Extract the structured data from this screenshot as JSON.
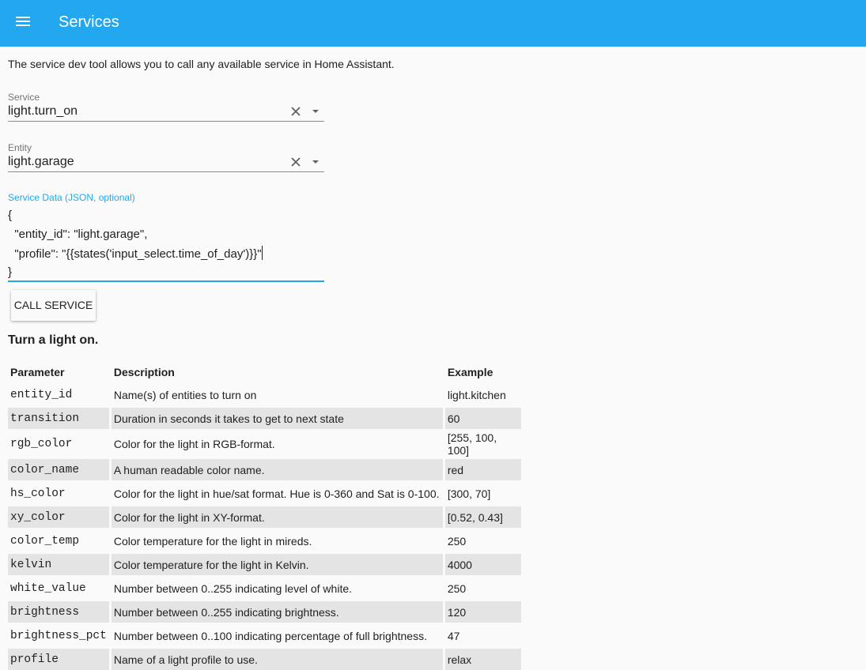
{
  "header": {
    "title": "Services",
    "menu_icon": "hamburger-menu-icon"
  },
  "intro": "The service dev tool allows you to call any available service in Home Assistant.",
  "service_field": {
    "label": "Service",
    "value": "light.turn_on"
  },
  "entity_field": {
    "label": "Entity",
    "value": "light.garage"
  },
  "service_data": {
    "label": "Service Data (JSON, optional)",
    "lines": [
      "{",
      "  \"entity_id\": \"light.garage\",",
      "  \"profile\": \"{{states('input_select.time_of_day')}}\"",
      "}"
    ]
  },
  "call_button": "CALL SERVICE",
  "section_title": "Turn a light on.",
  "table": {
    "headers": [
      "Parameter",
      "Description",
      "Example"
    ],
    "rows": [
      [
        "entity_id",
        "Name(s) of entities to turn on",
        "light.kitchen"
      ],
      [
        "transition",
        "Duration in seconds it takes to get to next state",
        "60"
      ],
      [
        "rgb_color",
        "Color for the light in RGB-format.",
        "[255, 100, 100]"
      ],
      [
        "color_name",
        "A human readable color name.",
        "red"
      ],
      [
        "hs_color",
        "Color for the light in hue/sat format. Hue is 0-360 and Sat is 0-100.",
        "[300, 70]"
      ],
      [
        "xy_color",
        "Color for the light in XY-format.",
        "[0.52, 0.43]"
      ],
      [
        "color_temp",
        "Color temperature for the light in mireds.",
        "250"
      ],
      [
        "kelvin",
        "Color temperature for the light in Kelvin.",
        "4000"
      ],
      [
        "white_value",
        "Number between 0..255 indicating level of white.",
        "250"
      ],
      [
        "brightness",
        "Number between 0..255 indicating brightness.",
        "120"
      ],
      [
        "brightness_pct",
        "Number between 0..100 indicating percentage of full brightness.",
        "47"
      ],
      [
        "profile",
        "Name of a light profile to use.",
        "relax"
      ]
    ]
  },
  "colors": {
    "accent": "#23a7ee",
    "row_shade": "#e4e4e4"
  }
}
